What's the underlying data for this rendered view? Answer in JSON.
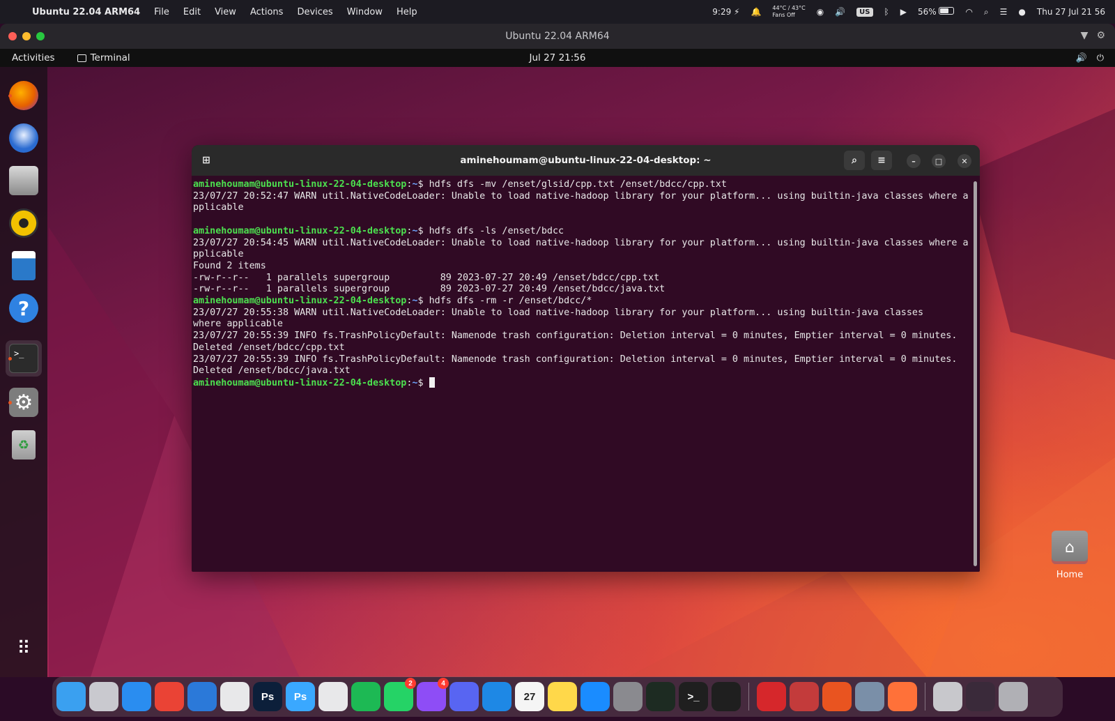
{
  "mac_menubar": {
    "app_name": "Ubuntu 22.04 ARM64",
    "menus": [
      "File",
      "Edit",
      "View",
      "Actions",
      "Devices",
      "Window",
      "Help"
    ],
    "time_short": "9:29",
    "temperature": "44°C / 43°C",
    "fans": "Fans Off",
    "keyboard_layout": "US",
    "battery_percent": "56%",
    "datetime": "Thu 27 Jul 21 56"
  },
  "vm_window": {
    "title": "Ubuntu 22.04 ARM64"
  },
  "ubuntu_topbar": {
    "activities_label": "Activities",
    "app_indicator_label": "Terminal",
    "clock": "Jul 27  21:56"
  },
  "terminal": {
    "title": "aminehoumam@ubuntu-linux-22-04-desktop: ~",
    "prompt_user": "aminehoumam@ubuntu-linux-22-04-desktop",
    "prompt_path": "~",
    "lines": [
      {
        "cmd": "hdfs dfs -mv /enset/glsid/cpp.txt /enset/bdcc/cpp.txt"
      },
      {
        "text": "23/07/27 20:52:47 WARN util.NativeCodeLoader: Unable to load native-hadoop library for your platform... using builtin-java classes where applicable"
      },
      {
        "text": ""
      },
      {
        "cmd": "hdfs dfs -ls /enset/bdcc"
      },
      {
        "text": "23/07/27 20:54:45 WARN util.NativeCodeLoader: Unable to load native-hadoop library for your platform... using builtin-java classes where applicable"
      },
      {
        "text": "Found 2 items"
      },
      {
        "text": "-rw-r--r--   1 parallels supergroup         89 2023-07-27 20:49 /enset/bdcc/cpp.txt"
      },
      {
        "text": "-rw-r--r--   1 parallels supergroup         89 2023-07-27 20:49 /enset/bdcc/java.txt"
      },
      {
        "cmd": "hdfs dfs -rm -r /enset/bdcc/*"
      },
      {
        "text": "23/07/27 20:55:38 WARN util.NativeCodeLoader: Unable to load native-hadoop library for your platform... using builtin-java classes\nwhere applicable"
      },
      {
        "text": "23/07/27 20:55:39 INFO fs.TrashPolicyDefault: Namenode trash configuration: Deletion interval = 0 minutes, Emptier interval = 0 minutes."
      },
      {
        "text": "Deleted /enset/bdcc/cpp.txt"
      },
      {
        "text": "23/07/27 20:55:39 INFO fs.TrashPolicyDefault: Namenode trash configuration: Deletion interval = 0 minutes, Emptier interval = 0 minutes."
      },
      {
        "text": "Deleted /enset/bdcc/java.txt"
      },
      {
        "cmd": "",
        "cursor": true
      }
    ]
  },
  "desktop": {
    "home_label": "Home"
  },
  "ubuntu_dock": [
    {
      "name": "firefox",
      "color": "#e66000",
      "running": true
    },
    {
      "name": "thunderbird",
      "color": "#2a6bd1",
      "running": false
    },
    {
      "name": "files",
      "color": "#8a8a8a",
      "running": false
    },
    {
      "name": "rhythmbox",
      "color": "#f2c200",
      "running": false
    },
    {
      "name": "libreoffice-writer",
      "color": "#2a79c9",
      "running": false
    },
    {
      "name": "help",
      "color": "#2f82e2",
      "running": false
    },
    {
      "name": "terminal",
      "color": "#2b2b2b",
      "running": true,
      "active": true
    },
    {
      "name": "settings",
      "color": "#7d7d7d",
      "running": true
    },
    {
      "name": "trash",
      "color": "#9a9a9a",
      "running": false
    }
  ],
  "mac_dock": {
    "apps": [
      {
        "name": "finder",
        "color": "#3aa0f0",
        "label": ""
      },
      {
        "name": "launchpad",
        "color": "#c9c9cf",
        "label": ""
      },
      {
        "name": "safari",
        "color": "#2a8df0",
        "label": ""
      },
      {
        "name": "chrome",
        "color": "#ea4335",
        "label": ""
      },
      {
        "name": "xcode",
        "color": "#2b79d9",
        "label": ""
      },
      {
        "name": "instruments",
        "color": "#e8e8ea",
        "label": ""
      },
      {
        "name": "photoshop-dark",
        "color": "#0c1f3a",
        "label": "Ps"
      },
      {
        "name": "photoshop-light",
        "color": "#3aa8ff",
        "label": "Ps"
      },
      {
        "name": "unity",
        "color": "#e8e8ea",
        "label": ""
      },
      {
        "name": "spotify",
        "color": "#1db954",
        "label": ""
      },
      {
        "name": "whatsapp",
        "color": "#25d366",
        "label": "",
        "badge": "2"
      },
      {
        "name": "messenger",
        "color": "#8e4df6",
        "label": "",
        "badge": "4"
      },
      {
        "name": "discord",
        "color": "#5865f2",
        "label": ""
      },
      {
        "name": "mountain",
        "color": "#1e88e5",
        "label": ""
      },
      {
        "name": "calendar",
        "color": "#f5f5f5",
        "label": "27"
      },
      {
        "name": "notes",
        "color": "#ffd84a",
        "label": ""
      },
      {
        "name": "app-store",
        "color": "#1a8cff",
        "label": ""
      },
      {
        "name": "system-preferences",
        "color": "#8a8a8f",
        "label": ""
      },
      {
        "name": "activity-monitor",
        "color": "#1d2b22",
        "label": ""
      },
      {
        "name": "terminal",
        "color": "#1f1f1f",
        "label": ">_"
      },
      {
        "name": "screens",
        "color": "#1f1f1f",
        "label": ""
      }
    ],
    "apps_right": [
      {
        "name": "parallels-ubuntu-vm",
        "color": "#d6272b",
        "label": ""
      },
      {
        "name": "parallels-desktop",
        "color": "#c33b3b",
        "label": ""
      },
      {
        "name": "ubuntu",
        "color": "#e95420",
        "label": ""
      },
      {
        "name": "preview",
        "color": "#7a8fa8",
        "label": ""
      },
      {
        "name": "firefox",
        "color": "#ff7139",
        "label": ""
      }
    ],
    "apps_folders": [
      {
        "name": "downloads-stack",
        "color": "#c8c8cc",
        "label": ""
      },
      {
        "name": "screenshot-stack",
        "color": "#3a2a3a",
        "label": ""
      },
      {
        "name": "trash",
        "color": "#b0b0b5",
        "label": ""
      }
    ]
  }
}
